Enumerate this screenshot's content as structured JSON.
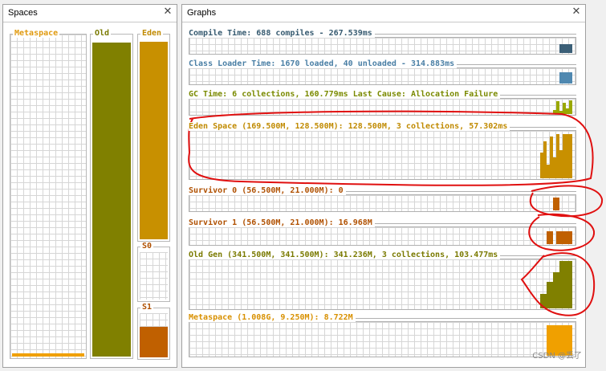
{
  "spaces_panel": {
    "title": "Spaces",
    "close_glyph": "✕",
    "spaces": [
      {
        "key": "metaspace",
        "label": "Metaspace",
        "label_color": "#e09a10",
        "fill_color": "#f0a000",
        "fill_fraction": 0.01
      },
      {
        "key": "old",
        "label": "Old",
        "label_color": "#7a7a00",
        "fill_color": "#808000",
        "fill_fraction": 0.99
      },
      {
        "key": "eden",
        "label": "Eden",
        "label_color": "#c08a00",
        "fill_color": "#c89000",
        "fill_fraction": 0.99
      },
      {
        "key": "s0",
        "label": "S0",
        "label_color": "#b05000",
        "fill_color": "#c06000",
        "fill_fraction": 0.0
      },
      {
        "key": "s1",
        "label": "S1",
        "label_color": "#b05000",
        "fill_color": "#c06000",
        "fill_fraction": 0.7
      }
    ]
  },
  "graphs_panel": {
    "title": "Graphs",
    "close_glyph": "✕",
    "graphs": [
      {
        "key": "compile",
        "label": "Compile Time: 688 compiles - 267.539ms",
        "color": "#365a70",
        "fill": "#3b5f77",
        "bars": [
          0.6,
          0.6,
          0.6,
          0.6
        ]
      },
      {
        "key": "classloader",
        "label": "Class Loader Time: 1670 loaded, 40 unloaded - 314.883ms",
        "color": "#4a7fa5",
        "fill": "#4f88b0",
        "bars": [
          0.8,
          0.8,
          0.8,
          0.8
        ]
      },
      {
        "key": "gc",
        "label": "GC Time: 6 collections, 160.779ms Last Cause: Allocation Failure",
        "color": "#7a8a00",
        "fill": "#9aa800",
        "bars": [
          0.3,
          0.9,
          0.2,
          0.8,
          0.4,
          0.95
        ]
      },
      {
        "key": "eden",
        "label": "Eden Space (169.500M, 128.500M): 128.500M, 3 collections, 57.302ms",
        "color": "#c08a00",
        "fill": "#c89000",
        "bars": [
          0.55,
          0.8,
          0.3,
          0.9,
          0.45,
          0.95,
          0.6,
          0.95,
          0.95,
          0.95
        ]
      },
      {
        "key": "s0",
        "label": "Survivor 0 (56.500M, 21.000M): 0",
        "color": "#b05000",
        "fill": "#c06000",
        "bars": [
          0,
          0,
          0.9,
          0.9,
          0,
          0,
          0,
          0
        ]
      },
      {
        "key": "s1",
        "label": "Survivor 1 (56.500M, 21.000M): 16.968M",
        "color": "#b05000",
        "fill": "#c06000",
        "bars": [
          0.8,
          0.8,
          0,
          0.8,
          0.8,
          0.8,
          0.8,
          0.8
        ]
      },
      {
        "key": "oldgen",
        "label": "Old Gen (341.500M, 341.500M): 341.236M, 3 collections, 103.477ms",
        "color": "#7a7a00",
        "fill": "#808000",
        "bars": [
          0.3,
          0.3,
          0.55,
          0.55,
          0.75,
          0.75,
          0.98,
          0.98,
          0.98,
          0.98
        ]
      },
      {
        "key": "meta",
        "label": "Metaspace (1.008G, 9.250M): 8.722M",
        "color": "#d89000",
        "fill": "#f0a000",
        "bars": [
          0.92,
          0.92,
          0.92,
          0.92,
          0.92,
          0.92,
          0.92,
          0.92
        ]
      }
    ]
  },
  "watermark": "CSDN @丢了",
  "annotation_color": "#e01010"
}
